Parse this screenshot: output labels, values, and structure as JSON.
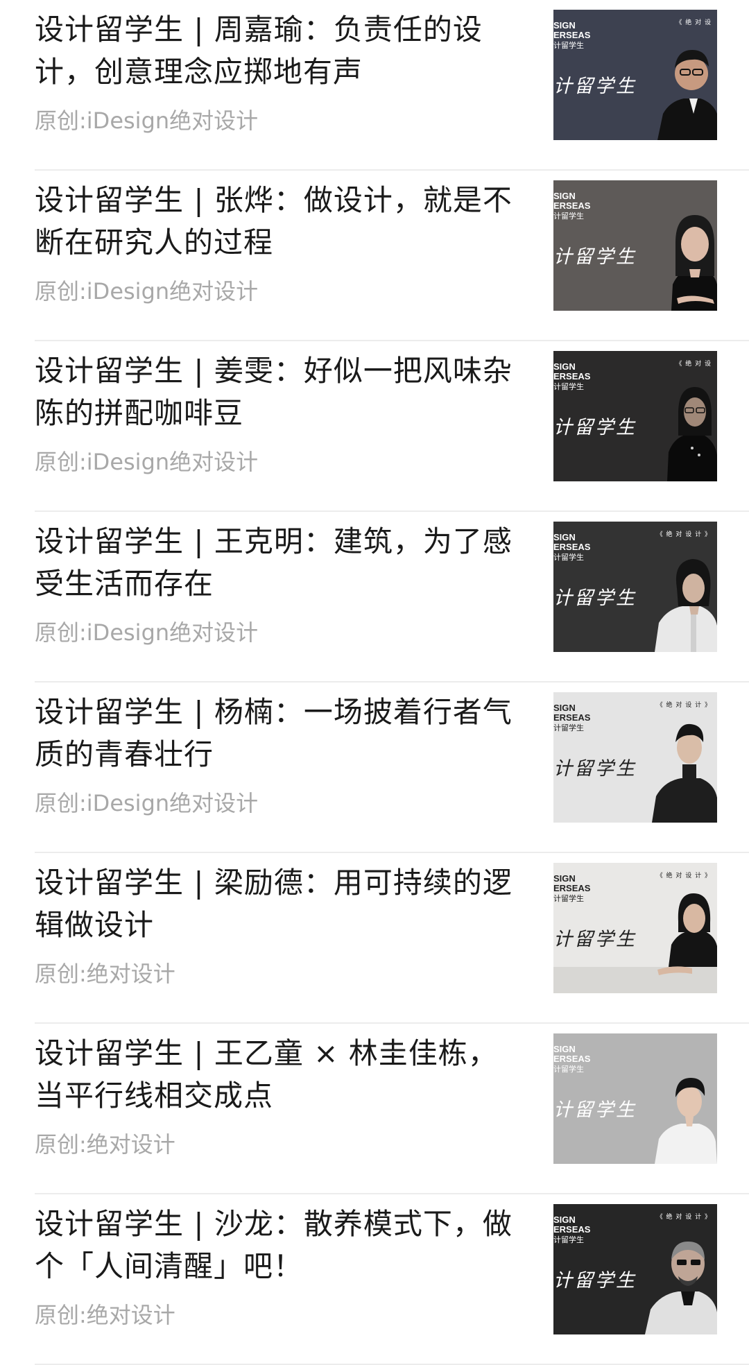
{
  "articles": [
    {
      "title": "设计留学生 | 周嘉瑜：负责任的设计，创意理念应掷地有声",
      "source": "原创:iDesign绝对设计",
      "thumb": {
        "bg": "#3d4150",
        "fg": "#ffffff",
        "en": "SIGN\nERSEAS",
        "cn_small": "计留学生",
        "cn_big": "计留学生",
        "brand": "《 绝 对 设"
      }
    },
    {
      "title": "设计留学生 | 张烨：做设计，就是不断在研究人的过程",
      "source": "原创:iDesign绝对设计",
      "thumb": {
        "bg": "#5e5a58",
        "fg": "#ffffff",
        "en": "SIGN\nERSEAS",
        "cn_small": "计留学生",
        "cn_big": "计留学生",
        "brand": ""
      }
    },
    {
      "title": "设计留学生 | 姜雯：好似一把风味杂陈的拼配咖啡豆",
      "source": "原创:iDesign绝对设计",
      "thumb": {
        "bg": "#2b2a2a",
        "fg": "#ffffff",
        "en": "SIGN\nERSEAS",
        "cn_small": "计留学生",
        "cn_big": "计留学生",
        "brand": "《 绝 对 设"
      }
    },
    {
      "title": "设计留学生 | 王克明：建筑，为了感受生活而存在",
      "source": "原创:iDesign绝对设计",
      "thumb": {
        "bg": "#333333",
        "fg": "#ffffff",
        "en": "SIGN\nERSEAS",
        "cn_small": "计留学生",
        "cn_big": "计留学生",
        "brand": "《 绝 对 设 计 》"
      }
    },
    {
      "title": "设计留学生 | 杨楠：一场披着行者气质的青春壮行",
      "source": "原创:iDesign绝对设计",
      "thumb": {
        "bg": "#e4e4e4",
        "fg": "#222222",
        "en": "SIGN\nERSEAS",
        "cn_small": "计留学生",
        "cn_big": "计留学生",
        "brand": "《 绝 对 设 计 》"
      }
    },
    {
      "title": "设计留学生 | 梁励德：用可持续的逻辑做设计",
      "source": "原创:绝对设计",
      "thumb": {
        "bg": "#e9e8e6",
        "fg": "#222222",
        "en": "SIGN\nERSEAS",
        "cn_small": "计留学生",
        "cn_big": "计留学生",
        "brand": "《 绝 对 设 计 》"
      }
    },
    {
      "title": "设计留学生 | 王乙童 × 林圭佳栋，当平行线相交成点",
      "source": "原创:绝对设计",
      "thumb": {
        "bg": "#b4b4b4",
        "fg": "#ffffff",
        "en": "SIGN\nERSEAS",
        "cn_small": "计留学生",
        "cn_big": "计留学生",
        "brand": ""
      }
    },
    {
      "title": "设计留学生 | 沙龙：散养模式下，做个「人间清醒」吧！",
      "source": "原创:绝对设计",
      "thumb": {
        "bg": "#262626",
        "fg": "#ffffff",
        "en": "SIGN\nERSEAS",
        "cn_small": "计留学生",
        "cn_big": "计留学生",
        "brand": "《 绝 对 设 计 》"
      }
    }
  ]
}
